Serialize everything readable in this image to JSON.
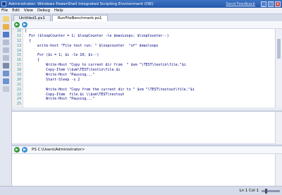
{
  "window": {
    "title": "Administrator: Windows PowerShell Integrated Scripting Environment (ISE)",
    "feedback_link": "Send Feedback",
    "minimize": "_",
    "maximize": "□",
    "close": "x"
  },
  "menu": [
    "File",
    "Edit",
    "View",
    "Debug",
    "Help"
  ],
  "tabs": [
    {
      "label": "Untitled1.ps1",
      "active": false
    },
    {
      "label": "RunFileBenchmark.ps1",
      "active": true
    }
  ],
  "editor": {
    "line_numbers": [
      "10",
      "11",
      "12",
      "13",
      "14",
      "15",
      "16",
      "17",
      "18",
      "19",
      "20",
      "21",
      "22",
      "23",
      "24",
      "25"
    ],
    "lines": [
      "{",
      "  For ($loopCounter = 1; $loopCounter -le $maxLoops; $loopCounter--)",
      "  {",
      "      write-host \"File test run: \" $loopcounter  \"of\" $maxloops",
      "",
      "      For ($i = 1; $i -le 10; $i--)",
      "      {",
      "          Write-Host \"Copy to current dir from  \" $vm \"\\TEST\\testin\\file.\"$i",
      "          Copy-Item \\\\$vm\\TEST\\testin\\file.$i",
      "          Write-Host \"Pausing...\"",
      "          Start-Sleep -s 2",
      "",
      "          Write-Host \"Copy from the current dir to \" $vm \"\\TEST\\testout\\file.\"$i",
      "          Copy-Item  file.$i \\\\$vm\\TEST\\testout",
      "          Write-Host \"Pausing...\"",
      ""
    ]
  },
  "command_pane": {
    "prompt": "PS C:\\Users\\Administrator>"
  },
  "status": {
    "position": "Ln 1  Col 1",
    "zoom_percent": 100
  }
}
